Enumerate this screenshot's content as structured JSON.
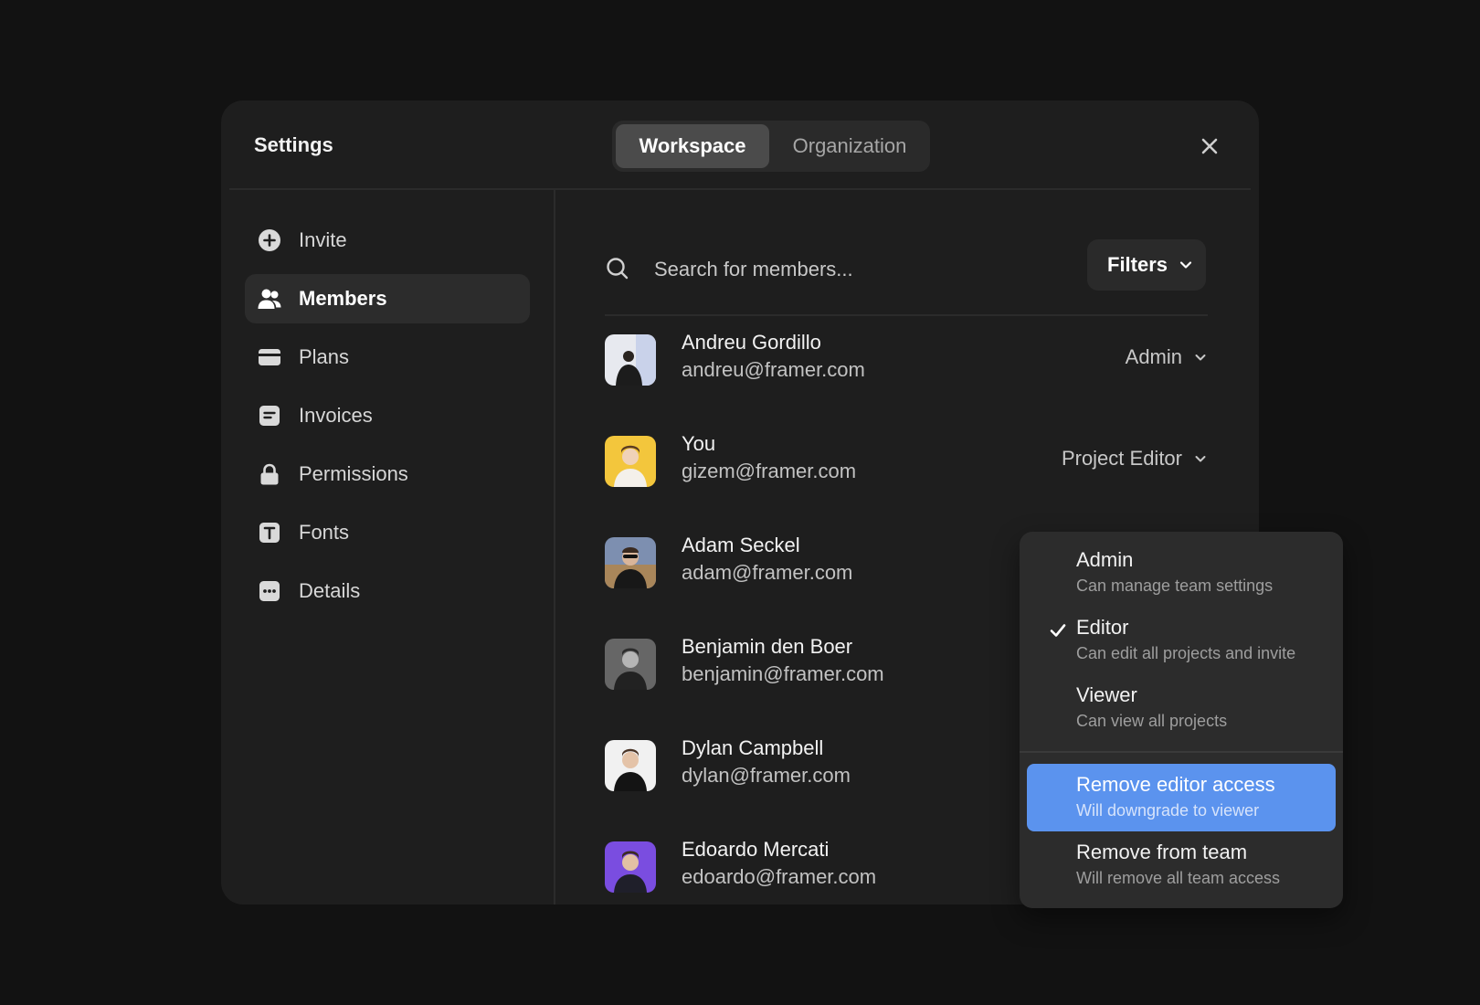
{
  "header": {
    "title": "Settings",
    "tabs": [
      {
        "label": "Workspace",
        "active": true
      },
      {
        "label": "Organization",
        "active": false
      }
    ]
  },
  "sidebar": {
    "items": [
      {
        "label": "Invite",
        "icon": "plus-circle-icon"
      },
      {
        "label": "Members",
        "icon": "users-icon",
        "active": true
      },
      {
        "label": "Plans",
        "icon": "credit-card-icon"
      },
      {
        "label": "Invoices",
        "icon": "document-icon"
      },
      {
        "label": "Permissions",
        "icon": "lock-icon"
      },
      {
        "label": "Fonts",
        "icon": "text-icon"
      },
      {
        "label": "Details",
        "icon": "more-icon"
      }
    ]
  },
  "search": {
    "placeholder": "Search for members...",
    "value": ""
  },
  "filters": {
    "label": "Filters"
  },
  "members": [
    {
      "name": "Andreu Gordillo",
      "email": "andreu@framer.com",
      "role": "Admin"
    },
    {
      "name": "You",
      "email": "gizem@framer.com",
      "role": "Project Editor"
    },
    {
      "name": "Adam Seckel",
      "email": "adam@framer.com",
      "role": ""
    },
    {
      "name": "Benjamin den Boer",
      "email": "benjamin@framer.com",
      "role": ""
    },
    {
      "name": "Dylan Campbell",
      "email": "dylan@framer.com",
      "role": ""
    },
    {
      "name": "Edoardo Mercati",
      "email": "edoardo@framer.com",
      "role": ""
    }
  ],
  "role_menu": {
    "options": [
      {
        "title": "Admin",
        "subtitle": "Can manage team settings",
        "checked": false
      },
      {
        "title": "Editor",
        "subtitle": "Can edit all projects and invite",
        "checked": true
      },
      {
        "title": "Viewer",
        "subtitle": "Can view all projects",
        "checked": false
      }
    ],
    "actions": [
      {
        "title": "Remove editor access",
        "subtitle": "Will downgrade to viewer",
        "highlighted": true
      },
      {
        "title": "Remove from team",
        "subtitle": "Will remove all team access",
        "highlighted": false
      }
    ]
  },
  "colors": {
    "background": "#121212",
    "modal": "#1e1e1e",
    "accent": "#5b93ee"
  }
}
